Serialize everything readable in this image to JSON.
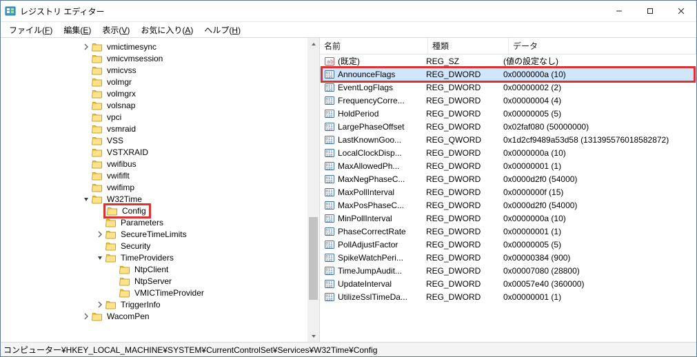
{
  "window": {
    "title": "レジストリ エディター"
  },
  "menu": {
    "items": [
      {
        "label_pre": "ファイル(",
        "ul": "F",
        "label_post": ")"
      },
      {
        "label_pre": "編集(",
        "ul": "E",
        "label_post": ")"
      },
      {
        "label_pre": "表示(",
        "ul": "V",
        "label_post": ")"
      },
      {
        "label_pre": "お気に入り(",
        "ul": "A",
        "label_post": ")"
      },
      {
        "label_pre": "ヘルプ(",
        "ul": "H",
        "label_post": ")"
      }
    ]
  },
  "tree": {
    "base_indent": 116,
    "indent_step": 20,
    "nodes": [
      {
        "depth": 0,
        "exp": "collapsed",
        "label": "vmictimesync"
      },
      {
        "depth": 0,
        "exp": "none",
        "label": "vmicvmsession"
      },
      {
        "depth": 0,
        "exp": "none",
        "label": "vmicvss"
      },
      {
        "depth": 0,
        "exp": "none",
        "label": "volmgr"
      },
      {
        "depth": 0,
        "exp": "none",
        "label": "volmgrx"
      },
      {
        "depth": 0,
        "exp": "none",
        "label": "volsnap"
      },
      {
        "depth": 0,
        "exp": "none",
        "label": "vpci"
      },
      {
        "depth": 0,
        "exp": "none",
        "label": "vsmraid"
      },
      {
        "depth": 0,
        "exp": "none",
        "label": "VSS"
      },
      {
        "depth": 0,
        "exp": "none",
        "label": "VSTXRAID"
      },
      {
        "depth": 0,
        "exp": "none",
        "label": "vwifibus"
      },
      {
        "depth": 0,
        "exp": "none",
        "label": "vwififlt"
      },
      {
        "depth": 0,
        "exp": "none",
        "label": "vwifimp"
      },
      {
        "depth": 0,
        "exp": "expanded",
        "label": "W32Time"
      },
      {
        "depth": 1,
        "exp": "none",
        "label": "Config",
        "highlight": true
      },
      {
        "depth": 1,
        "exp": "none",
        "label": "Parameters"
      },
      {
        "depth": 1,
        "exp": "collapsed",
        "label": "SecureTimeLimits"
      },
      {
        "depth": 1,
        "exp": "none",
        "label": "Security"
      },
      {
        "depth": 1,
        "exp": "expanded",
        "label": "TimeProviders"
      },
      {
        "depth": 2,
        "exp": "none",
        "label": "NtpClient"
      },
      {
        "depth": 2,
        "exp": "none",
        "label": "NtpServer"
      },
      {
        "depth": 2,
        "exp": "none",
        "label": "VMICTimeProvider"
      },
      {
        "depth": 1,
        "exp": "collapsed",
        "label": "TriggerInfo"
      },
      {
        "depth": 0,
        "exp": "collapsed",
        "label": "WacomPen"
      }
    ]
  },
  "list": {
    "headers": {
      "name": "名前",
      "type": "種類",
      "data": "データ"
    },
    "rows": [
      {
        "icon": "str",
        "name": "(既定)",
        "type": "REG_SZ",
        "data": "(値の設定なし)"
      },
      {
        "icon": "bin",
        "name": "AnnounceFlags",
        "type": "REG_DWORD",
        "data": "0x0000000a (10)",
        "selected": true,
        "highlight": true
      },
      {
        "icon": "bin",
        "name": "EventLogFlags",
        "type": "REG_DWORD",
        "data": "0x00000002 (2)"
      },
      {
        "icon": "bin",
        "name": "FrequencyCorre...",
        "type": "REG_DWORD",
        "data": "0x00000004 (4)"
      },
      {
        "icon": "bin",
        "name": "HoldPeriod",
        "type": "REG_DWORD",
        "data": "0x00000005 (5)"
      },
      {
        "icon": "bin",
        "name": "LargePhaseOffset",
        "type": "REG_DWORD",
        "data": "0x02faf080 (50000000)"
      },
      {
        "icon": "bin",
        "name": "LastKnownGoo...",
        "type": "REG_QWORD",
        "data": "0x1d2cf9489a53d58 (131395576018582872)"
      },
      {
        "icon": "bin",
        "name": "LocalClockDisp...",
        "type": "REG_DWORD",
        "data": "0x0000000a (10)"
      },
      {
        "icon": "bin",
        "name": "MaxAllowedPh...",
        "type": "REG_DWORD",
        "data": "0x00000001 (1)"
      },
      {
        "icon": "bin",
        "name": "MaxNegPhaseC...",
        "type": "REG_DWORD",
        "data": "0x0000d2f0 (54000)"
      },
      {
        "icon": "bin",
        "name": "MaxPollInterval",
        "type": "REG_DWORD",
        "data": "0x0000000f (15)"
      },
      {
        "icon": "bin",
        "name": "MaxPosPhaseC...",
        "type": "REG_DWORD",
        "data": "0x0000d2f0 (54000)"
      },
      {
        "icon": "bin",
        "name": "MinPollInterval",
        "type": "REG_DWORD",
        "data": "0x0000000a (10)"
      },
      {
        "icon": "bin",
        "name": "PhaseCorrectRate",
        "type": "REG_DWORD",
        "data": "0x00000001 (1)"
      },
      {
        "icon": "bin",
        "name": "PollAdjustFactor",
        "type": "REG_DWORD",
        "data": "0x00000005 (5)"
      },
      {
        "icon": "bin",
        "name": "SpikeWatchPeri...",
        "type": "REG_DWORD",
        "data": "0x00000384 (900)"
      },
      {
        "icon": "bin",
        "name": "TimeJumpAudit...",
        "type": "REG_DWORD",
        "data": "0x00007080 (28800)"
      },
      {
        "icon": "bin",
        "name": "UpdateInterval",
        "type": "REG_DWORD",
        "data": "0x00057e40 (360000)"
      },
      {
        "icon": "bin",
        "name": "UtilizeSslTimeDa...",
        "type": "REG_DWORD",
        "data": "0x00000001 (1)"
      }
    ]
  },
  "statusbar": {
    "path": "コンピューター¥HKEY_LOCAL_MACHINE¥SYSTEM¥CurrentControlSet¥Services¥W32Time¥Config"
  }
}
